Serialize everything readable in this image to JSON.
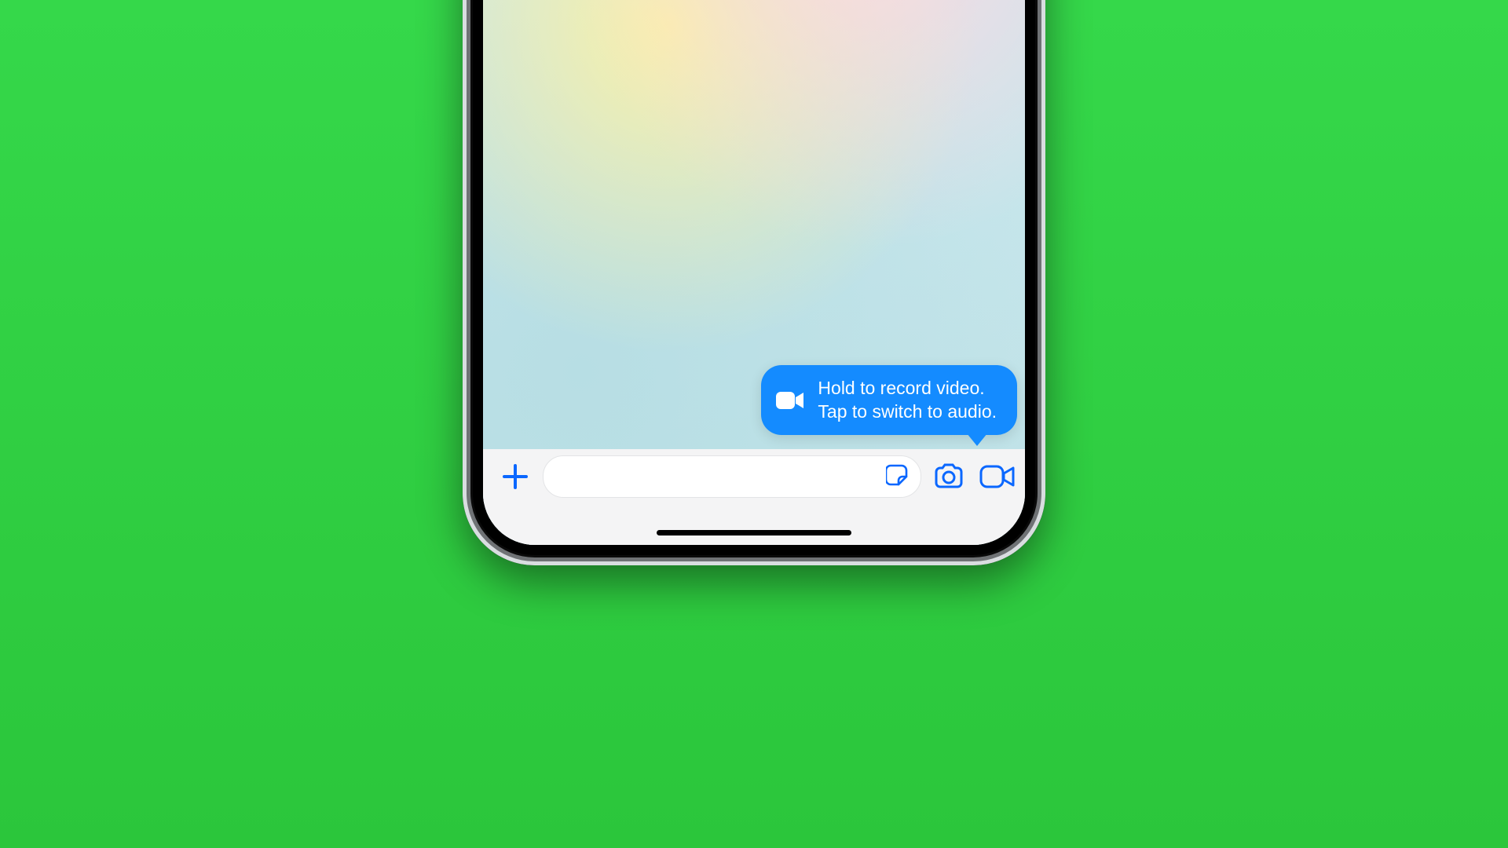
{
  "tooltip": {
    "line1": "Hold to record video.",
    "line2": "Tap to switch to audio.",
    "icon": "video-icon"
  },
  "inputbar": {
    "add_icon": "plus-icon",
    "sticker_icon": "sticker-icon",
    "camera_icon": "camera-icon",
    "video_icon": "video-icon",
    "placeholder": ""
  },
  "colors": {
    "accent": "#148bff",
    "icon_blue": "#0a67ff",
    "background_green": "#2ecc40"
  }
}
